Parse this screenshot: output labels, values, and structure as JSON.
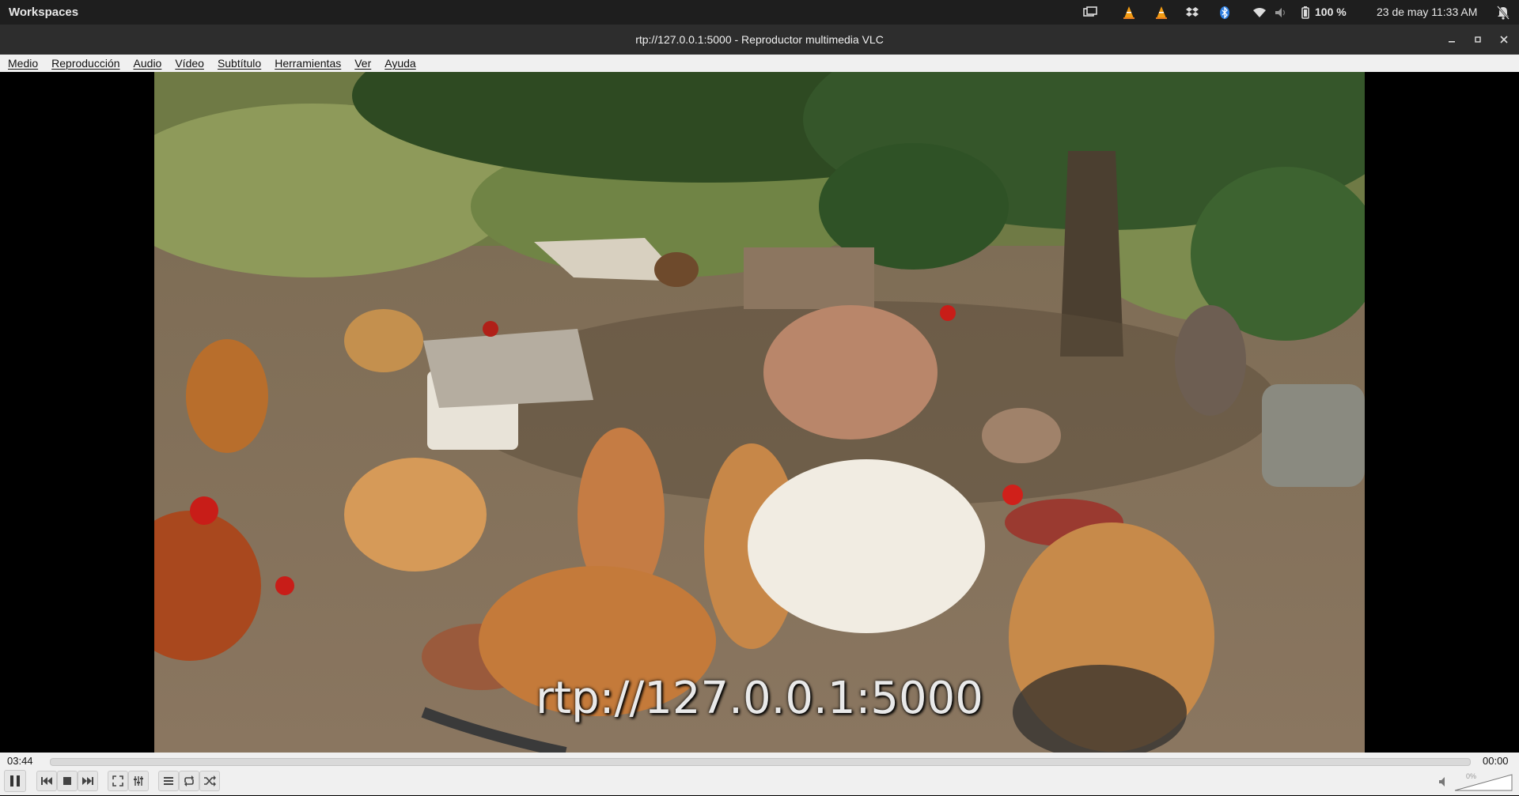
{
  "panel": {
    "workspaces": "Workspaces",
    "battery": "100 %",
    "datetime": "23 de may  11:33 AM",
    "icons": [
      "monitor-icon",
      "vlc-tray-icon",
      "vlc-tray-icon",
      "dropbox-icon",
      "bluetooth-icon",
      "wifi-icon",
      "volume-icon",
      "battery-icon",
      "notifications-icon"
    ]
  },
  "window": {
    "title": "rtp://127.0.0.1:5000 - Reproductor multimedia VLC"
  },
  "menu": [
    "Medio",
    "Reproducción",
    "Audio",
    "Vídeo",
    "Subtítulo",
    "Herramientas",
    "Ver",
    "Ayuda"
  ],
  "video": {
    "overlay_text": "rtp://127.0.0.1:5000"
  },
  "controls": {
    "elapsed": "03:44",
    "remaining": "00:00",
    "volume_label": "0%",
    "volume_level": 0
  }
}
